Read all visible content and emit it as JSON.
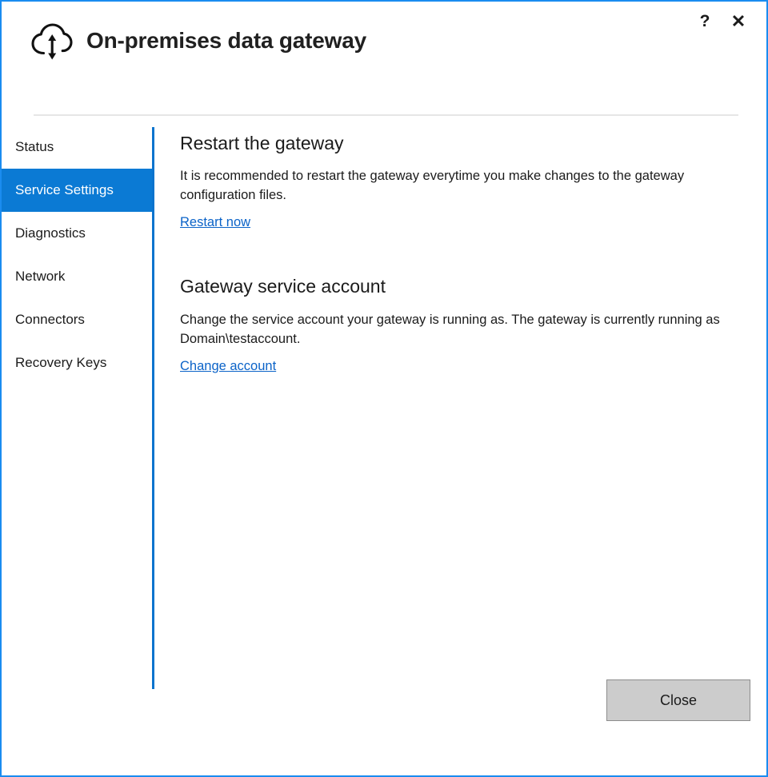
{
  "window": {
    "title": "On-premises data gateway",
    "app_icon": "cloud-sync-icon",
    "border_color": "#1a8cf0",
    "controls": {
      "help_label": "?",
      "help_icon": "question-mark-icon",
      "close_label": "✕",
      "close_icon": "close-x-icon"
    }
  },
  "sidebar": {
    "selected_index": 1,
    "accent_color": "#0b7ad4",
    "items": [
      {
        "label": "Status",
        "name": "status"
      },
      {
        "label": "Service Settings",
        "name": "service-settings"
      },
      {
        "label": "Diagnostics",
        "name": "diagnostics"
      },
      {
        "label": "Network",
        "name": "network"
      },
      {
        "label": "Connectors",
        "name": "connectors"
      },
      {
        "label": "Recovery Keys",
        "name": "recovery-keys"
      }
    ]
  },
  "content": {
    "sections": [
      {
        "title": "Restart the gateway",
        "description": "It is recommended to restart the gateway everytime you make changes to the gateway configuration files.",
        "link_label": "Restart now"
      },
      {
        "title": "Gateway service account",
        "description": "Change the service account your gateway is running as. The gateway is currently running as Domain\\testaccount.",
        "link_label": "Change account"
      }
    ]
  },
  "footer": {
    "close_label": "Close"
  },
  "colors": {
    "link": "#0b63c8",
    "heading": "#1b1b1b",
    "divider": "#e6e6e6",
    "button_face": "#cccccc"
  }
}
